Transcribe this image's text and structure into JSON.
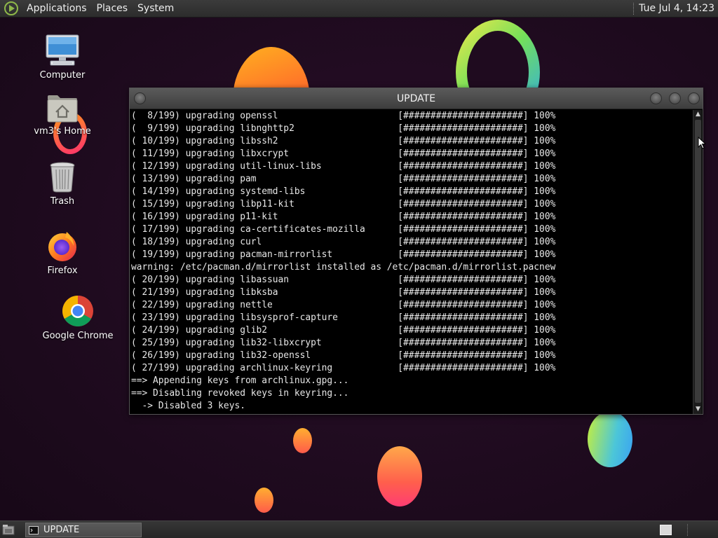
{
  "top_panel": {
    "menus": [
      "Applications",
      "Places",
      "System"
    ],
    "clock": "Tue Jul  4, 14:23"
  },
  "desktop_icons": [
    {
      "label": "Computer",
      "icon": "computer-icon"
    },
    {
      "label": "vm3's Home",
      "icon": "home-folder-icon"
    },
    {
      "label": "Trash",
      "icon": "trash-icon"
    },
    {
      "label": "Firefox",
      "icon": "firefox-icon"
    },
    {
      "label": "Google Chrome",
      "icon": "chrome-icon"
    }
  ],
  "terminal": {
    "title": "UPDATE",
    "lines": [
      "(  8/199) upgrading openssl                      [######################] 100%",
      "(  9/199) upgrading libnghttp2                   [######################] 100%",
      "( 10/199) upgrading libssh2                      [######################] 100%",
      "( 11/199) upgrading libxcrypt                    [######################] 100%",
      "( 12/199) upgrading util-linux-libs              [######################] 100%",
      "( 13/199) upgrading pam                          [######################] 100%",
      "( 14/199) upgrading systemd-libs                 [######################] 100%",
      "( 15/199) upgrading libp11-kit                   [######################] 100%",
      "( 16/199) upgrading p11-kit                      [######################] 100%",
      "( 17/199) upgrading ca-certificates-mozilla      [######################] 100%",
      "( 18/199) upgrading curl                         [######################] 100%",
      "( 19/199) upgrading pacman-mirrorlist            [######################] 100%",
      "warning: /etc/pacman.d/mirrorlist installed as /etc/pacman.d/mirrorlist.pacnew",
      "( 20/199) upgrading libassuan                    [######################] 100%",
      "( 21/199) upgrading libksba                      [######################] 100%",
      "( 22/199) upgrading nettle                       [######################] 100%",
      "( 23/199) upgrading libsysprof-capture           [######################] 100%",
      "( 24/199) upgrading glib2                        [######################] 100%",
      "( 25/199) upgrading lib32-libxcrypt              [######################] 100%",
      "( 26/199) upgrading lib32-openssl                [######################] 100%",
      "( 27/199) upgrading archlinux-keyring            [######################] 100%",
      "==> Appending keys from archlinux.gpg...",
      "==> Disabling revoked keys in keyring...",
      "  -> Disabled 3 keys."
    ]
  },
  "taskbar": {
    "tasks": [
      {
        "label": "UPDATE",
        "icon": "terminal-icon"
      }
    ]
  }
}
